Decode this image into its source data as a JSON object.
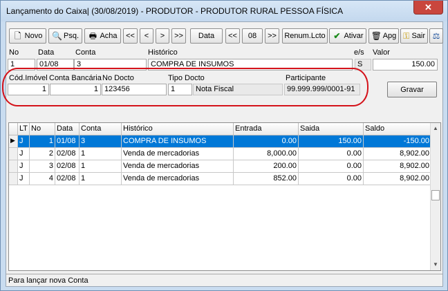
{
  "window": {
    "title": "Lançamento do Caixa| (30/08/2019) - PRODUTOR - PRODUTOR RURAL PESSOA FÍSICA",
    "close_glyph": "✕"
  },
  "toolbar": {
    "novo": "Novo",
    "psq": "Psq.",
    "acha": "Acha",
    "first": "<<",
    "prev": "<",
    "next": ">",
    "last": ">>",
    "data": "Data",
    "month_prev": "<<",
    "month": "08",
    "month_next": ">>",
    "renum": "Renum.Lcto",
    "ativar": "Ativar",
    "apg": "Apg",
    "sair": "Sair"
  },
  "entry": {
    "labels": {
      "no": "No",
      "data": "Data",
      "conta": "Conta",
      "historico": "Histórico",
      "es": "e/s",
      "valor": "Valor"
    },
    "values": {
      "no": "1",
      "data": "01/08",
      "conta": "3",
      "historico": "COMPRA DE INSUMOS",
      "es": "S",
      "valor": "150.00"
    }
  },
  "detail": {
    "labels": {
      "cod_imovel": "Cód.Imóvel",
      "conta_bancaria": "Conta Bancária",
      "no_docto": "No Docto",
      "tipo_docto": "Tipo Docto",
      "participante": "Participante"
    },
    "values": {
      "cod_imovel": "1",
      "conta_bancaria": "1",
      "no_docto": "123456",
      "tipo_docto_code": "1",
      "tipo_docto_desc": "Nota Fiscal",
      "participante": "99.999.999/0001-91"
    }
  },
  "gravar_label": "Gravar",
  "grid": {
    "headers": [
      "LT",
      "No",
      "Data",
      "Conta",
      "Histórico",
      "Entrada",
      "Saida",
      "Saldo"
    ],
    "rows": [
      {
        "lt": "J",
        "no": "1",
        "data": "01/08",
        "conta": "3",
        "historico": "COMPRA DE INSUMOS",
        "entrada": "0.00",
        "saida": "150.00",
        "saldo": "-150.00"
      },
      {
        "lt": "J",
        "no": "2",
        "data": "02/08",
        "conta": "1",
        "historico": "Venda de mercadorias",
        "entrada": "8,000.00",
        "saida": "0.00",
        "saldo": "8,902.00"
      },
      {
        "lt": "J",
        "no": "3",
        "data": "02/08",
        "conta": "1",
        "historico": "Venda de mercadorias",
        "entrada": "200.00",
        "saida": "0.00",
        "saldo": "8,902.00"
      },
      {
        "lt": "J",
        "no": "4",
        "data": "02/08",
        "conta": "1",
        "historico": "Venda de mercadorias",
        "entrada": "852.00",
        "saida": "0.00",
        "saldo": "8,902.00"
      }
    ]
  },
  "status": "Para lançar nova Conta"
}
